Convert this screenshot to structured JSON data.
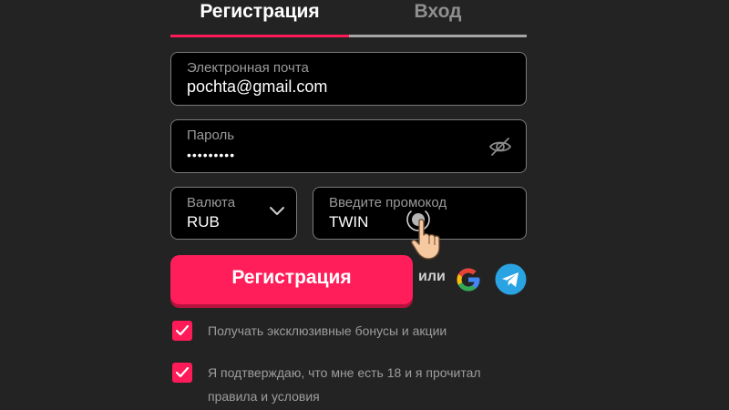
{
  "tabs": {
    "register": "Регистрация",
    "login": "Вход",
    "active_color": "#ff1a58"
  },
  "form": {
    "email_label": "Электронная почта",
    "email_value": "pochta@gmail.com",
    "password_label": "Пароль",
    "password_value": "•••••••••",
    "password_toggle_icon": "eye-off-icon",
    "currency_label": "Валюта",
    "currency_value": "RUB",
    "promo_label": "Введите промокод",
    "promo_value": "TWIN"
  },
  "actions": {
    "register_label": "Регистрация",
    "register_color": "#ff1e5a",
    "or_label": "или",
    "social": [
      "google-icon",
      "telegram-icon"
    ]
  },
  "consents": [
    {
      "label": "Получать эксклюзивные бонусы и акции",
      "checked": true
    },
    {
      "label": "Я подтверждаю, что мне есть 18 и я прочитал правила и условия",
      "checked": true
    }
  ]
}
